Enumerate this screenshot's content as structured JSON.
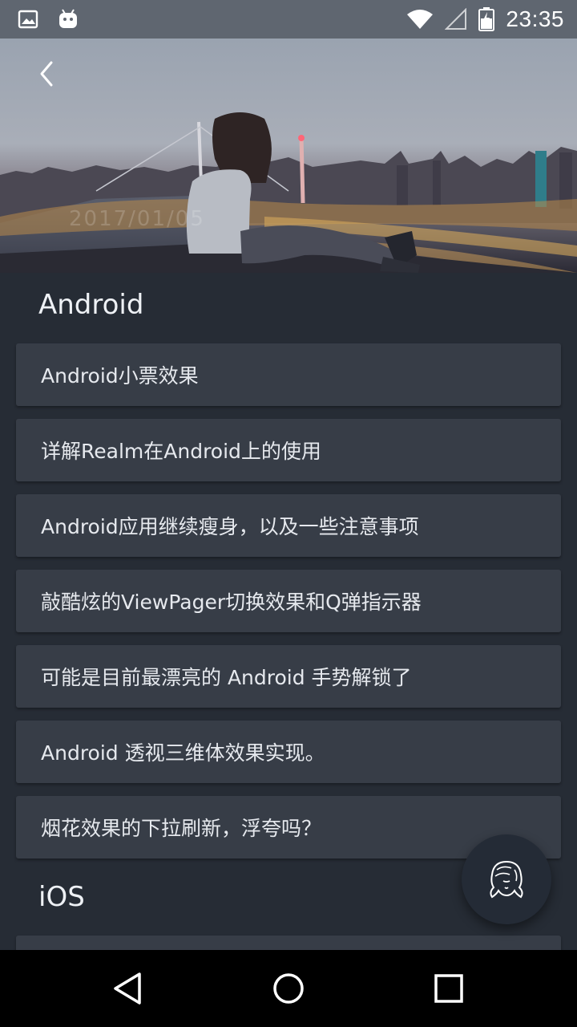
{
  "status_bar": {
    "time": "23:35",
    "icons": [
      "image-notification-icon",
      "android-notification-icon",
      "wifi-icon",
      "signal-icon",
      "battery-charging-icon"
    ]
  },
  "header": {
    "back_icon": "back-arrow-icon",
    "watermark_date": "2017/01/05"
  },
  "sections": [
    {
      "title": "Android",
      "items": [
        "Android小票效果",
        "详解Realm在Android上的使用",
        "Android应用继续瘦身，以及一些注意事项",
        "敲酷炫的ViewPager切换效果和Q弹指示器",
        "可能是目前最漂亮的 Android 手势解锁了",
        "Android 透视三维体效果实现。",
        "烟花效果的下拉刷新，浮夸吗？"
      ]
    },
    {
      "title": "iOS",
      "items": [
        ""
      ]
    }
  ],
  "fab": {
    "icon": "girl-portrait-icon"
  },
  "nav_bar": {
    "icons": [
      "back-triangle-icon",
      "home-circle-icon",
      "recents-square-icon"
    ]
  },
  "colors": {
    "background": "#262c35",
    "card": "#373d47",
    "status_bar": "#5f6670",
    "fab": "#242b36"
  }
}
